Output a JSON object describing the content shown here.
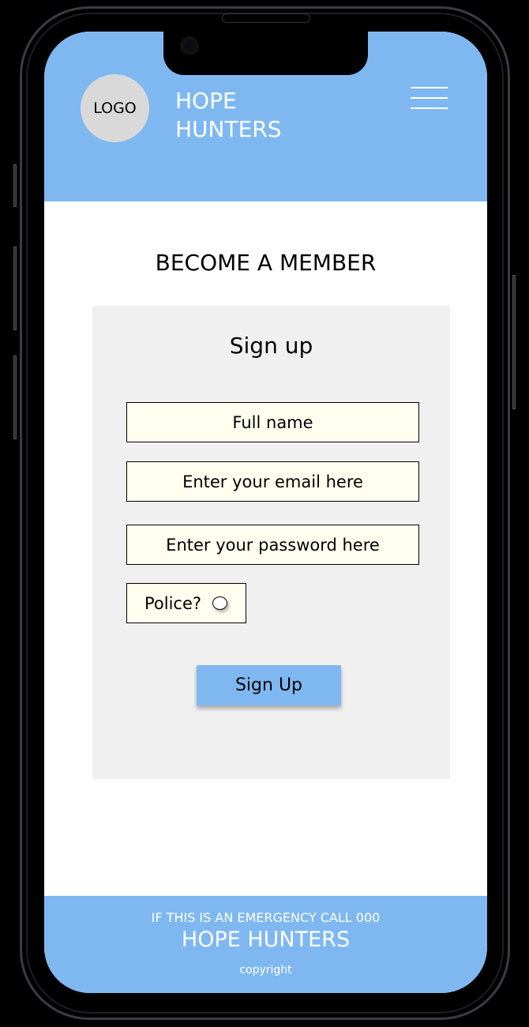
{
  "header": {
    "logo": "LOGO",
    "brand_line1": "HOPE",
    "brand_line2": "HUNTERS"
  },
  "main": {
    "title": "BECOME A MEMBER",
    "form": {
      "heading": "Sign up",
      "full_name_placeholder": "Full name",
      "email_placeholder": "Enter your email here",
      "password_placeholder": "Enter your password here",
      "police_label": "Police?",
      "submit_label": "Sign Up"
    }
  },
  "footer": {
    "emergency": "IF THIS IS AN EMERGENCY CALL 000",
    "brand": "HOPE HUNTERS",
    "copyright": "copyright"
  },
  "colors": {
    "accent": "#7fb8f1",
    "input_bg": "#fffff0",
    "card_bg": "#f0f0f0"
  }
}
